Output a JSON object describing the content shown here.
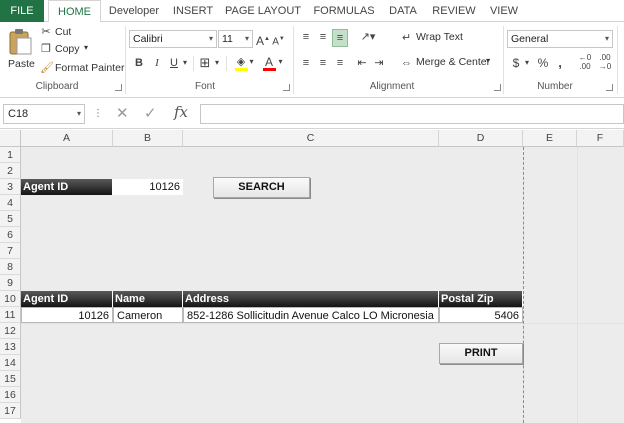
{
  "tabs": [
    "FILE",
    "HOME",
    "Developer",
    "INSERT",
    "PAGE LAYOUT",
    "FORMULAS",
    "DATA",
    "REVIEW",
    "VIEW"
  ],
  "clipboard": {
    "paste": "Paste",
    "cut": "Cut",
    "copy": "Copy",
    "format_painter": "Format Painter",
    "label": "Clipboard"
  },
  "font": {
    "name": "Calibri",
    "size": "11",
    "bold": "B",
    "italic": "I",
    "underline": "U",
    "label": "Font"
  },
  "alignment": {
    "wrap_text": "Wrap Text",
    "merge_center": "Merge & Center",
    "label": "Alignment"
  },
  "number": {
    "format": "General",
    "currency": "$",
    "percent": "%",
    "comma": ",",
    "label": "Number"
  },
  "formula_bar": {
    "cell_ref": "C18",
    "fx": "fx",
    "value": ""
  },
  "columns": [
    "A",
    "B",
    "C",
    "D",
    "E",
    "F"
  ],
  "rows": [
    "1",
    "2",
    "3",
    "4",
    "5",
    "6",
    "7",
    "8",
    "9",
    "10",
    "11",
    "12",
    "13",
    "14",
    "15",
    "16",
    "17"
  ],
  "search": {
    "agent_id_label": "Agent ID",
    "agent_id_value": "10126",
    "button": "SEARCH"
  },
  "table": {
    "headers": [
      "Agent ID",
      "Name",
      "Address",
      "Postal Zip"
    ],
    "row": [
      "10126",
      "Cameron",
      "852-1286 Sollicitudin Avenue Calco LO Micronesia",
      "5406"
    ]
  },
  "print_button": "PRINT",
  "colors": {
    "accent": "#217346",
    "header_dark": "#141414"
  }
}
